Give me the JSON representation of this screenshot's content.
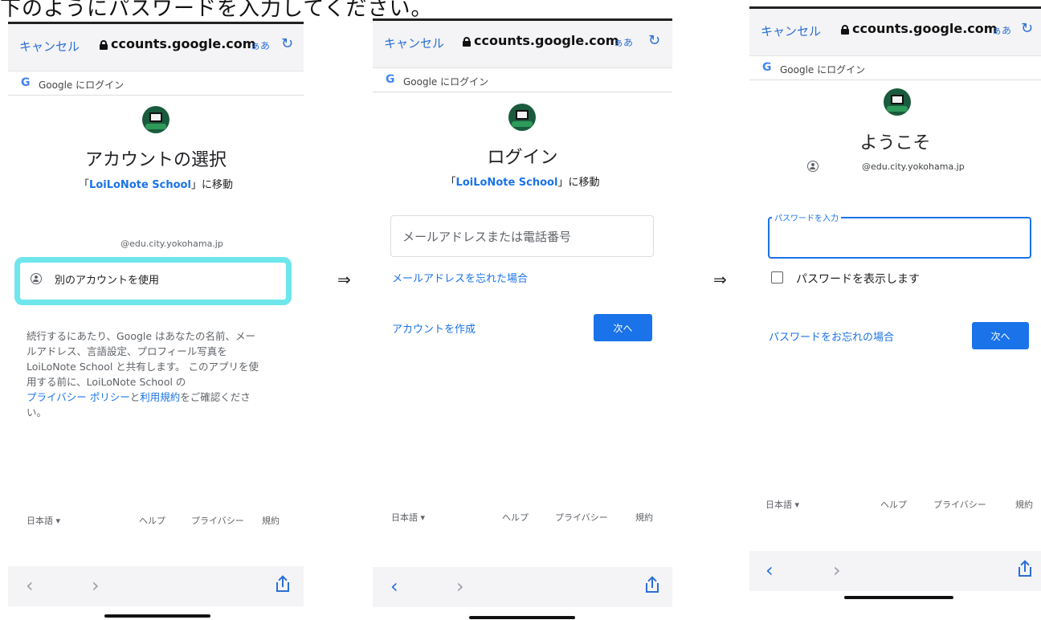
{
  "headline": "下のようにパスワードを入力してください。",
  "arrows": [
    "⇒",
    "⇒"
  ],
  "browser": {
    "cancel_label": "キャンセル",
    "url": "ccounts.google.com",
    "text_size_label": "ぁあ",
    "reload_icon": "reload-icon",
    "google_bar_logo": "G",
    "google_bar_text": "Google にログイン"
  },
  "footer": {
    "language": "日本語 ▾",
    "help": "ヘルプ",
    "privacy": "プライバシー",
    "terms": "規約"
  },
  "nav": {
    "back": "‹",
    "forward": "›"
  },
  "screen1": {
    "title": "アカウントの選択",
    "subtitle_prefix": "「",
    "app_name": "LoiLoNote School",
    "subtitle_suffix": "」に移動",
    "account_email": "@edu.city.yokohama.jp",
    "use_other_account": "別のアカウントを使用",
    "consent_line1": "続行するにあたり、Google はあなたの名前、メー",
    "consent_line2": "ルアドレス、言語設定、プロフィール写真を",
    "consent_line3": "LoiLoNote School と共有します。 このアプリを使",
    "consent_line4": "用する前に、LoiLoNote School の",
    "privacy_policy_link": "プライバシー ポリシー",
    "consent_and": "と",
    "terms_link": "利用規約",
    "consent_line5_end": "をご確認くださ",
    "consent_line6": "い。"
  },
  "screen2": {
    "title": "ログイン",
    "subtitle_prefix": "「",
    "app_name": "LoiLoNote School",
    "subtitle_suffix": "」に移動",
    "email_placeholder": "メールアドレスまたは電話番号",
    "forgot_email": "メールアドレスを忘れた場合",
    "create_account": "アカウントを作成",
    "next_button": "次へ"
  },
  "screen3": {
    "title": "ようこそ",
    "account_email": "@edu.city.yokohama.jp",
    "password_label": "パスワードを入力",
    "show_password": "パスワードを表示します",
    "forgot_password": "パスワードをお忘れの場合",
    "next_button": "次へ"
  }
}
